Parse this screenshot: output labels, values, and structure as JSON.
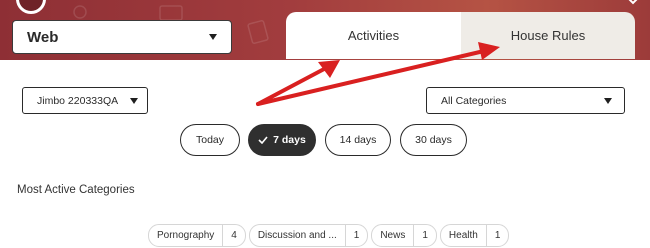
{
  "platform_select": {
    "value": "Web"
  },
  "tabs": [
    {
      "label": "Activities",
      "active": true
    },
    {
      "label": "House Rules",
      "active": false
    }
  ],
  "filters": {
    "device": "Jimbo 220333QA",
    "category": "All Categories"
  },
  "time_ranges": [
    {
      "label": "Today",
      "active": false
    },
    {
      "label": "7 days",
      "active": true
    },
    {
      "label": "14 days",
      "active": false
    },
    {
      "label": "30 days",
      "active": false
    }
  ],
  "most_active": {
    "title": "Most Active Categories",
    "categories": [
      {
        "name": "Pornography",
        "count": "4"
      },
      {
        "name": "Discussion and ...",
        "count": "1"
      },
      {
        "name": "News",
        "count": "1"
      },
      {
        "name": "Health",
        "count": "1"
      }
    ]
  },
  "colors": {
    "banner": "#a23d3e",
    "annotation_arrow": "#d92020",
    "active_pill": "#2f2f2f",
    "inactive_tab": "#efece7"
  }
}
